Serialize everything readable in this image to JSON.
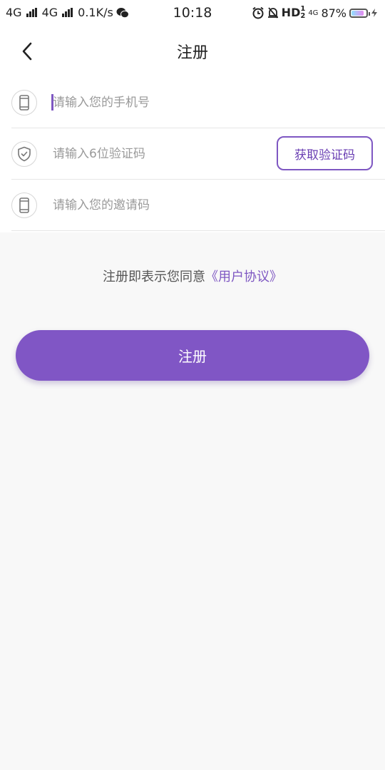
{
  "status_bar": {
    "network1": "4G",
    "network2": "4G",
    "speed": "0.1K/s",
    "time": "10:18",
    "hd": "HD",
    "hd_sup": "1",
    "hd_sub": "2",
    "net_small": "4G",
    "battery_percent": "87%",
    "battery_level": 0.87
  },
  "header": {
    "title": "注册"
  },
  "form": {
    "phone_placeholder": "请输入您的手机号",
    "code_placeholder": "请输入6位验证码",
    "get_code_label": "获取验证码",
    "invite_placeholder": "请输入您的邀请码"
  },
  "agreement": {
    "prefix": "注册即表示您同意",
    "link": "《用户协议》"
  },
  "actions": {
    "register_label": "注册"
  },
  "icons": {
    "back": "chevron-left-icon",
    "phone": "phone-icon",
    "shield": "shield-check-icon",
    "invite": "phone-icon"
  },
  "colors": {
    "accent": "#8056c5",
    "background": "#f8f8f8"
  }
}
